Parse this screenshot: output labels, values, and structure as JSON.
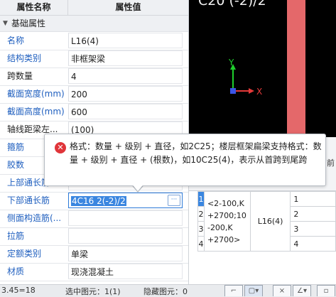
{
  "panel": {
    "header_name": "属性名称",
    "header_value": "属性值",
    "group_label": "基础属性",
    "rows": [
      {
        "name": "名称",
        "value": "L16(4)",
        "color": "blue"
      },
      {
        "name": "结构类别",
        "value": "非框架梁",
        "color": "blue"
      },
      {
        "name": "跨数量",
        "value": "4",
        "color": "dark"
      },
      {
        "name": "截面宽度(mm)",
        "value": "200",
        "color": "blue"
      },
      {
        "name": "截面高度(mm)",
        "value": "600",
        "color": "blue"
      },
      {
        "name": "轴线距梁左...",
        "value": "(100)",
        "color": "dark"
      },
      {
        "name": "箍筋",
        "value": "",
        "color": "blue"
      },
      {
        "name": "胶数",
        "value": "",
        "color": "blue"
      },
      {
        "name": "上部通长筋",
        "value": "",
        "color": "blue"
      },
      {
        "name": "下部通长筋",
        "value": "4C16 2(-2)/2",
        "color": "blue"
      },
      {
        "name": "侧面构造筋(...",
        "value": "",
        "color": "blue"
      },
      {
        "name": "拉筋",
        "value": "",
        "color": "blue"
      },
      {
        "name": "定额类别",
        "value": "单梁",
        "color": "blue"
      },
      {
        "name": "材质",
        "value": "现浇混凝土",
        "color": "blue"
      }
    ],
    "dots_label": "···"
  },
  "canvas": {
    "label": "C20 (-2)/2",
    "axis_y": "Y",
    "axis_x": "X"
  },
  "tooltip": {
    "icon": "✕",
    "text": "格式：数量 + 级别 + 直径，如2C25；楼层框架扁梁支持格式：数量 + 级别 + 直径 + (根数)，如10C25(4)，表示从首跨到尾跨"
  },
  "right_table": {
    "header_partial": "当前",
    "left_cells": [
      "1",
      "2",
      "3",
      "4"
    ],
    "mid_lines": [
      "<2-100,K",
      "+2700;10",
      "-200,K",
      "+2700>"
    ],
    "name": "L16(4)",
    "indices": [
      "1",
      "2",
      "3",
      "4"
    ]
  },
  "status": {
    "coords": "3.45=18",
    "selected": "选中图元：1(1)",
    "hidden": "隐藏图元：0"
  },
  "colors": {
    "accent": "#2b79d8",
    "label_blue": "#1f5fbf",
    "beam_red": "#e4686a",
    "error_red": "#e0353a"
  }
}
